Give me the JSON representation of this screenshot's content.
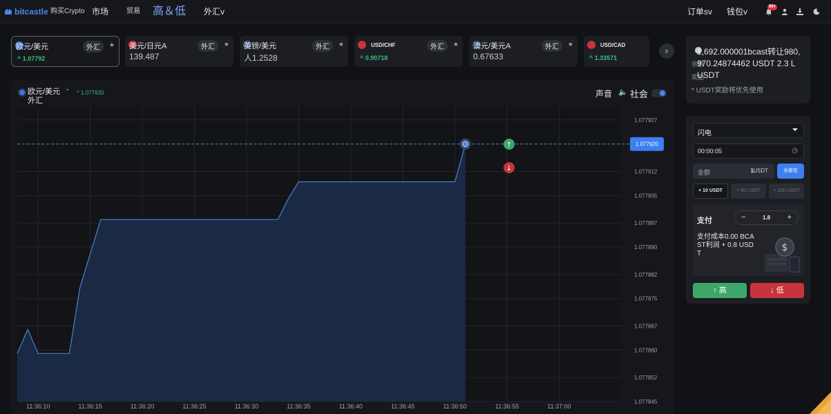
{
  "nav": {
    "brand": "bitcastle",
    "buy_crypto": "购买Crypto",
    "market": "市场",
    "trade": "贸易",
    "high_low": "高＆低",
    "forex": "外汇v",
    "orders": "订单sv",
    "wallet": "钱包v",
    "notifications_badge": "99+",
    "icons": [
      "bell-icon",
      "user-icon",
      "download-icon",
      "moon-icon"
    ]
  },
  "tickers": [
    {
      "name": "欧元/美元",
      "tag": "外汇",
      "price": "^ 1.07792",
      "price_style": "green",
      "flag": "eu-flag-icon",
      "active": true
    },
    {
      "name": "美元/日元A",
      "tag": "外汇",
      "price": "139.487",
      "price_style": "white",
      "flag": "us-flag-icon",
      "active": false
    },
    {
      "name": "英镑/美元",
      "tag": "外汇",
      "price": "人1.2528",
      "price_style": "white",
      "flag": "uk-flag-icon",
      "active": false
    },
    {
      "name": "USD/CHF",
      "tag": "外汇",
      "price": "^ 0.90718",
      "price_style": "green",
      "flag": "us-flag-icon",
      "active": false
    },
    {
      "name": "澳元/美元A",
      "tag": "外汇",
      "price": "0.67633",
      "price_style": "white",
      "flag": "au-flag-icon",
      "active": false
    },
    {
      "name": "USD/CAD",
      "tag": "",
      "price": "^ 1.33571",
      "price_style": "green",
      "flag": "us-flag-icon",
      "active": false
    }
  ],
  "chart_header": {
    "pair": "欧元/美元",
    "type": "外汇",
    "price": "^ 1.077920",
    "sound_label": "声音",
    "social_label": "社会",
    "social_enabled": true
  },
  "chart_data": {
    "type": "area",
    "title": "",
    "xlabel": "",
    "ylabel": "",
    "x_ticks": [
      "11:36:10",
      "11:36:15",
      "11:36:20",
      "11:36:25",
      "11:36:30",
      "11:36:35",
      "11:36:40",
      "11:36:45",
      "11:36:50",
      "11:36:55",
      "11:37:00"
    ],
    "y_ticks": [
      "1.077927",
      "1.077920",
      "1.077912",
      "1.077905",
      "1.077897",
      "1.077890",
      "1.077882",
      "1.077875",
      "1.077867",
      "1.077860",
      "1.077852",
      "1.077845"
    ],
    "ylim": [
      1.077845,
      1.077931
    ],
    "xlim": [
      "11:36:08",
      "11:37:06"
    ],
    "current_price": "1.077920",
    "series": [
      {
        "x": [
          "11:36:08",
          "11:36:09",
          "11:36:10",
          "11:36:12",
          "11:36:13",
          "11:36:14",
          "11:36:15",
          "11:36:16",
          "11:36:17",
          "11:36:18",
          "11:36:20",
          "11:36:25",
          "11:36:30",
          "11:36:33",
          "11:36:34",
          "11:36:35",
          "11:36:40",
          "11:36:45",
          "11:36:49",
          "11:36:50",
          "11:36:51"
        ],
        "y": [
          1.077859,
          1.077866,
          1.077859,
          1.077859,
          1.077859,
          1.077878,
          1.077888,
          1.077898,
          1.077898,
          1.077898,
          1.077898,
          1.077898,
          1.077898,
          1.077898,
          1.077904,
          1.077909,
          1.077909,
          1.077909,
          1.077909,
          1.077909,
          1.07792
        ]
      }
    ],
    "colors": {
      "line": "#4f7fcf",
      "fill": "#1a2a45",
      "grid": "#23262c",
      "up": "#3fa66a",
      "down": "#c8343b",
      "marker": "#4f86e8"
    }
  },
  "bonus": {
    "balance_label": "余额",
    "bonus_label": "奖励",
    "text": "1,692.000001bcast转让980,970.24874462 USDT 2.3 L USDT",
    "note": "* USDT奖励将优先使用"
  },
  "trade": {
    "mode": "闪电",
    "duration": "00:00:05",
    "amount_label": "金额",
    "amount_value": "1",
    "amount_currency": "USDT",
    "all_button": "全部在",
    "quick_amounts": [
      "+ 10 USDT",
      "+ 50 USDT",
      "+ 100 USDT"
    ],
    "payout_label": "支付",
    "payout_multiplier": "1.8",
    "stepper_minus": "−",
    "stepper_plus": "+",
    "payout_desc": "支付成本0.00 BCAST利润 + 0.8 USDT",
    "high_button": "高",
    "low_button": "低"
  }
}
